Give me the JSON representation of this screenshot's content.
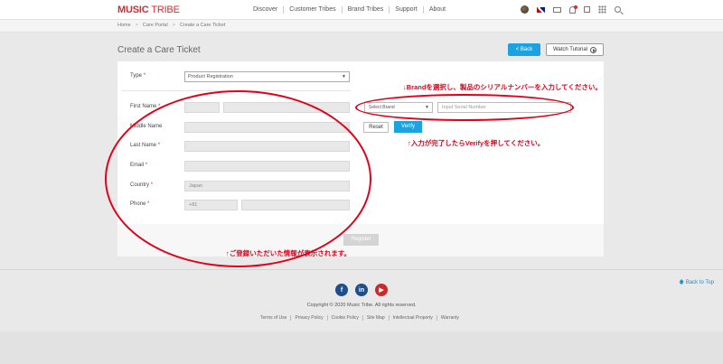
{
  "header": {
    "logo_main": "MUSIC",
    "logo_sub": "TRIBE",
    "nav": [
      "Discover",
      "Customer Tribes",
      "Brand Tribes",
      "Support",
      "About"
    ],
    "icons": [
      "avatar-icon",
      "flag-uk-icon",
      "mail-icon",
      "bell-icon",
      "box-icon",
      "apps-grid-icon",
      "search-icon"
    ]
  },
  "breadcrumb": [
    "Home",
    "Care Portal",
    "Create a Care Ticket"
  ],
  "page": {
    "title": "Create a Care Ticket",
    "back_label": "< Back",
    "tutorial_label": "Watch Tutorial"
  },
  "form": {
    "type_label": "Type",
    "type_value": "Product Registration",
    "first_name_label": "First Name",
    "middle_name_label": "Middle Name",
    "last_name_label": "Last Name",
    "email_label": "Email",
    "country_label": "Country",
    "country_value": "Japan",
    "phone_label": "Phone",
    "phone_code": "+81",
    "required_mark": "*",
    "register_label": "Register"
  },
  "product": {
    "brand_placeholder": "Select Brand",
    "serial_placeholder": "Input Serial Number",
    "reset_label": "Reset",
    "verify_label": "Verify"
  },
  "annotations": {
    "note_brand": "↓Brandを選択し、製品のシリアルナンバーを入力してください。",
    "note_verify": "↑入力が完了したらVerifyを押してください。",
    "note_info": "↑ご登録いただいた情報が表示されます。",
    "color": "#e2001a"
  },
  "footer": {
    "back_to_top": "Back to Top",
    "copyright": "Copyright © 2020 Music Tribe. All rights reserved.",
    "links": [
      "Terms of Use",
      "Privacy Policy",
      "Cookie Policy",
      "Site Map",
      "Intellectual Property",
      "Warranty"
    ]
  },
  "colors": {
    "accent": "#1aa3e0",
    "brand_red": "#d8282f"
  }
}
